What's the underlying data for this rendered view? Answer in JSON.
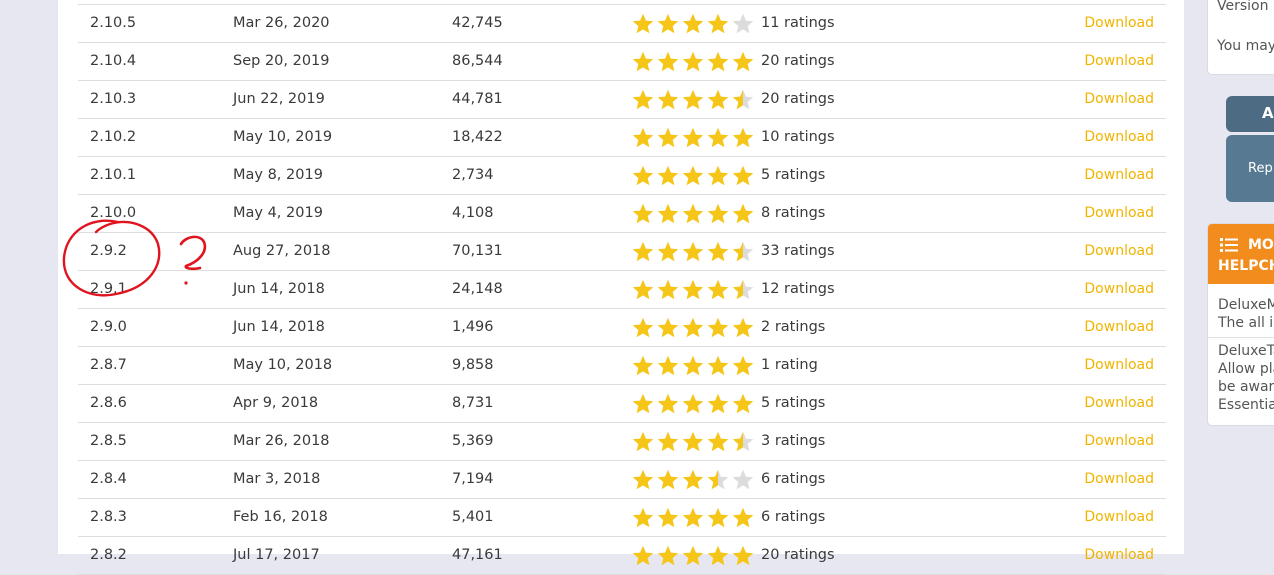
{
  "versions": [
    {
      "version": "2.10.5",
      "date": "Mar 26, 2020",
      "downloads": "42,745",
      "rating": 4.0,
      "ratings_text": "11 ratings",
      "link": "Download"
    },
    {
      "version": "2.10.4",
      "date": "Sep 20, 2019",
      "downloads": "86,544",
      "rating": 5.0,
      "ratings_text": "20 ratings",
      "link": "Download"
    },
    {
      "version": "2.10.3",
      "date": "Jun 22, 2019",
      "downloads": "44,781",
      "rating": 4.5,
      "ratings_text": "20 ratings",
      "link": "Download"
    },
    {
      "version": "2.10.2",
      "date": "May 10, 2019",
      "downloads": "18,422",
      "rating": 5.0,
      "ratings_text": "10 ratings",
      "link": "Download"
    },
    {
      "version": "2.10.1",
      "date": "May 8, 2019",
      "downloads": "2,734",
      "rating": 5.0,
      "ratings_text": "5 ratings",
      "link": "Download"
    },
    {
      "version": "2.10.0",
      "date": "May 4, 2019",
      "downloads": "4,108",
      "rating": 5.0,
      "ratings_text": "8 ratings",
      "link": "Download"
    },
    {
      "version": "2.9.2",
      "date": "Aug 27, 2018",
      "downloads": "70,131",
      "rating": 4.5,
      "ratings_text": "33 ratings",
      "link": "Download"
    },
    {
      "version": "2.9.1",
      "date": "Jun 14, 2018",
      "downloads": "24,148",
      "rating": 4.5,
      "ratings_text": "12 ratings",
      "link": "Download"
    },
    {
      "version": "2.9.0",
      "date": "Jun 14, 2018",
      "downloads": "1,496",
      "rating": 5.0,
      "ratings_text": "2 ratings",
      "link": "Download"
    },
    {
      "version": "2.8.7",
      "date": "May 10, 2018",
      "downloads": "9,858",
      "rating": 5.0,
      "ratings_text": "1 rating",
      "link": "Download"
    },
    {
      "version": "2.8.6",
      "date": "Apr 9, 2018",
      "downloads": "8,731",
      "rating": 5.0,
      "ratings_text": "5 ratings",
      "link": "Download"
    },
    {
      "version": "2.8.5",
      "date": "Mar 26, 2018",
      "downloads": "5,369",
      "rating": 4.5,
      "ratings_text": "3 ratings",
      "link": "Download"
    },
    {
      "version": "2.8.4",
      "date": "Mar 3, 2018",
      "downloads": "7,194",
      "rating": 3.5,
      "ratings_text": "6 ratings",
      "link": "Download"
    },
    {
      "version": "2.8.3",
      "date": "Feb 16, 2018",
      "downloads": "5,401",
      "rating": 5.0,
      "ratings_text": "6 ratings",
      "link": "Download"
    },
    {
      "version": "2.8.2",
      "date": "Jul 17, 2017",
      "downloads": "47,161",
      "rating": 5.0,
      "ratings_text": "20 ratings",
      "link": "Download"
    }
  ],
  "colors": {
    "star_filled": "#f5c518",
    "star_empty": "#dcdcdc",
    "download_link": "#f0b400",
    "annotation": "#e0141e",
    "orange_header": "#f28c1c",
    "button_blue": "#4d6c83"
  },
  "sidebar": {
    "top_card": {
      "line1": "Version I",
      "line2": "You may"
    },
    "button1_label": "As",
    "button2_label": "Repl",
    "more": {
      "icon": "list-icon",
      "header_line1": "MO",
      "header_line2": "HELPCH",
      "items": [
        {
          "title": "DeluxeM",
          "desc": "The all in"
        },
        {
          "title": "DeluxeTa",
          "desc1": "Allow pla",
          "desc2": "be award",
          "desc3": "Essentia"
        }
      ]
    }
  },
  "annotation": {
    "marker": "?"
  }
}
